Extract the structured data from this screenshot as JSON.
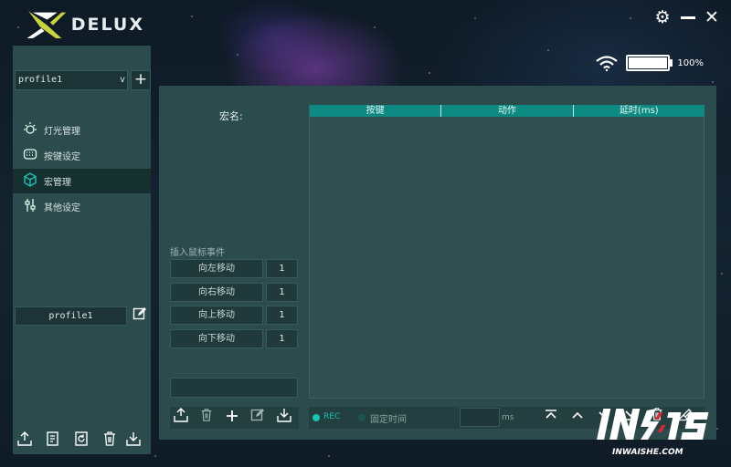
{
  "app": {
    "brand": "DELUX"
  },
  "window_controls": {
    "settings_icon": "gear-icon",
    "minimize_icon": "minimize-icon",
    "close_icon": "close-icon"
  },
  "status": {
    "battery_percent": "100%",
    "battery_level": 1.0,
    "wifi_icon": "wifi-icon"
  },
  "sidebar": {
    "profile_select": "profile1",
    "profile_chevron": "v",
    "add_label": "+",
    "items": [
      {
        "label": "灯光管理",
        "icon": "light-bulb-icon"
      },
      {
        "label": "按键设定",
        "icon": "keyboard-icon"
      },
      {
        "label": "宏管理",
        "icon": "macro-cube-icon"
      },
      {
        "label": "其他设定",
        "icon": "sliders-icon"
      }
    ],
    "active_index": 2,
    "profile_name": "profile1",
    "bottom_tools": [
      "import-icon",
      "notes-icon",
      "reset-icon",
      "delete-icon",
      "export-icon"
    ]
  },
  "macro": {
    "name_label": "宏名:",
    "table_headers": [
      "按键",
      "动作",
      "延时(ms)"
    ],
    "mouse_events_title": "插入鼠标事件",
    "moves": [
      {
        "label": "向左移动",
        "value": "1"
      },
      {
        "label": "向右移动",
        "value": "1"
      },
      {
        "label": "向上移动",
        "value": "1"
      },
      {
        "label": "向下移动",
        "value": "1"
      }
    ],
    "left_tools": [
      "import-icon",
      "delete-icon",
      "add-icon",
      "edit-icon",
      "save-icon"
    ],
    "rec_label": "REC",
    "fixed_time_label": "固定时间",
    "ms_unit": "ms",
    "right_tools": [
      "move-top-icon",
      "move-up-icon",
      "move-down-icon",
      "move-bottom-icon",
      "delete-icon",
      "clear-icon"
    ]
  },
  "watermark": {
    "text": "IN外设",
    "subtext": "INWAISHE.COM"
  },
  "colors": {
    "accent": "#0d8b82",
    "panel": "#2c4b4d",
    "rec": "#16c3b4"
  }
}
